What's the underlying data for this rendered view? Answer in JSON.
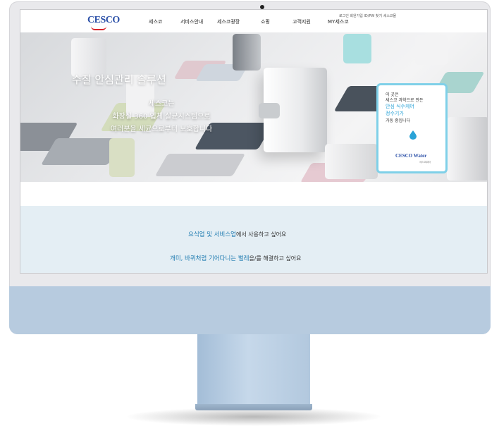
{
  "header": {
    "logo": "CESCO",
    "nav": [
      {
        "label": "세스코"
      },
      {
        "label": "서비스안내"
      },
      {
        "label": "세스코광장"
      },
      {
        "label": "쇼핑"
      },
      {
        "label": "고객지원"
      },
      {
        "label": "MY세스코"
      }
    ],
    "util_links": "로그인  회원가입  ID/PW 찾기  세스코몰"
  },
  "hero": {
    "title": "수질 안심관리 솔루션",
    "subtitle_1": "세스코는",
    "subtitle_2": "화장실 360 입체 살균시스템으로",
    "subtitle_3": "여러분을 세균으로부터 보호합니다"
  },
  "promo_card": {
    "line_1": "이 곳은",
    "line_2": "세스코 과학으로 만든",
    "line_3": "안심 식수케어",
    "line_4": "정수기가",
    "line_5": "가동 중입니다",
    "logo": "CESCO Water",
    "logo_sub": "세스코워터",
    "drop_icon": "water-drop-icon",
    "border_color": "#7fd0e8"
  },
  "info": {
    "line_1_highlight": "요식업 및 서비스업",
    "line_1_rest": "에서 사용하고 싶어요",
    "line_2_highlight": "개미, 바퀴처럼 기어다니는 벌레",
    "line_2_rest": "을/를 해결하고 싶어요",
    "highlight_color": "#1e7bb0",
    "band_color": "#e4eef4"
  },
  "monitor": {
    "chin_color": "#b7cbdf"
  }
}
